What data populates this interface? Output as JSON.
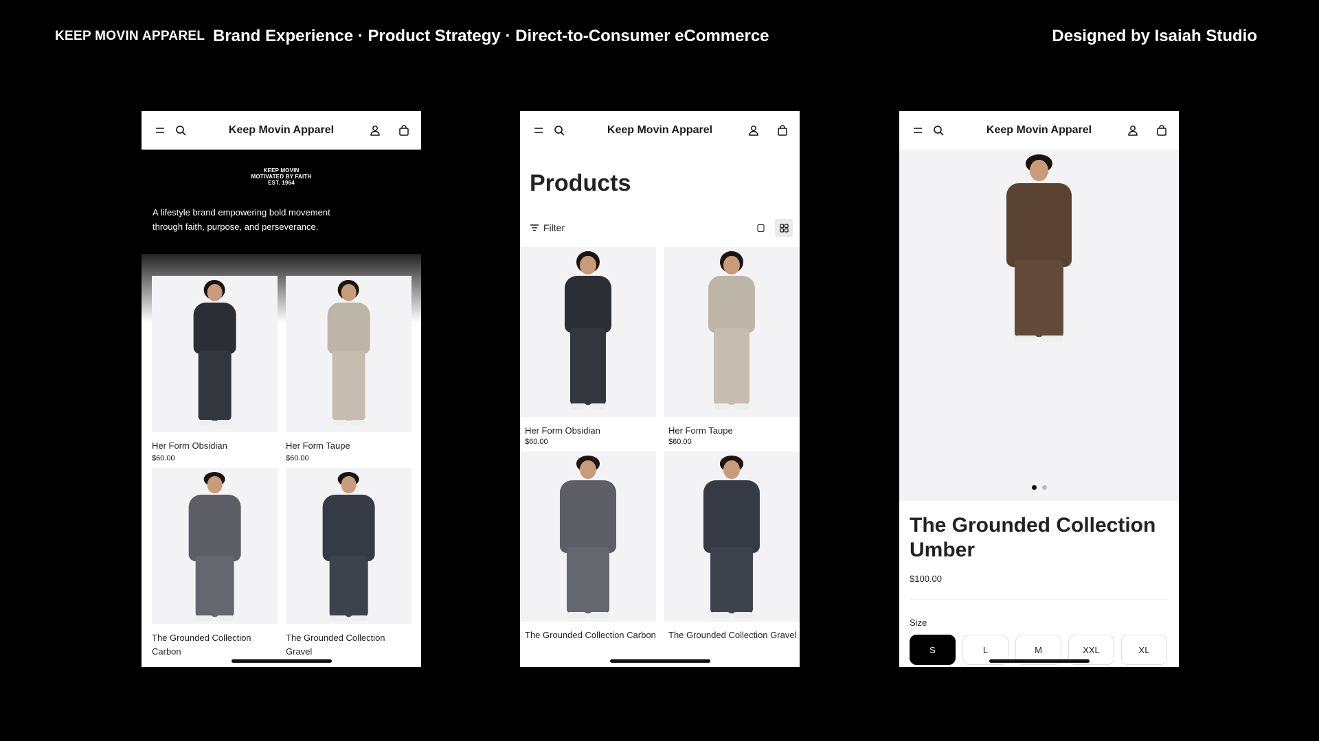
{
  "header": {
    "brand": "KEEP MOVIN APPAREL",
    "tagline": "Brand Experience · Product Strategy · Direct-to-Consumer eCommerce",
    "credit": "Designed by Isaiah Studio"
  },
  "store": {
    "title": "Keep Movin Apparel",
    "icons": [
      "menu-icon",
      "search-icon",
      "account-icon",
      "bag-icon"
    ]
  },
  "home": {
    "logo_lines": [
      "KEEP MOVIN",
      "MOTIVATED BY FAITH",
      "EST. 1964"
    ],
    "description": "A lifestyle brand empowering bold movement through faith, purpose, and perseverance.",
    "products": [
      {
        "name": "Her Form Obsidian",
        "price": "$60.00",
        "tone": "#2b2e34"
      },
      {
        "name": "Her Form Taupe",
        "price": "$60.00",
        "tone": "#bdb5a8"
      },
      {
        "name": "The Grounded Collection Carbon",
        "price": "",
        "tone": "#5e5f66"
      },
      {
        "name": "The Grounded Collection Gravel",
        "price": "",
        "tone": "#353a44"
      }
    ]
  },
  "catalog": {
    "title": "Products",
    "filter_label": "Filter",
    "products": [
      {
        "name": "Her Form Obsidian",
        "price": "$60.00",
        "tone": "#2b2e34"
      },
      {
        "name": "Her Form Taupe",
        "price": "$60.00",
        "tone": "#bdb5a8"
      },
      {
        "name": "The Grounded Collection Carbon",
        "price": "",
        "tone": "#5e5f66"
      },
      {
        "name": "The Grounded Collection Gravel",
        "price": "",
        "tone": "#353a44"
      }
    ]
  },
  "product_detail": {
    "title": "The Grounded Collection Umber",
    "price": "$100.00",
    "tone": "#5a4232",
    "size_label": "Size",
    "sizes": [
      "S",
      "L",
      "M",
      "XXL",
      "XL"
    ],
    "selected_size": "S"
  },
  "colors": {
    "background": "#000000",
    "surface": "#ffffff",
    "image_bg": "#f3f3f5",
    "accent": "#000000"
  }
}
